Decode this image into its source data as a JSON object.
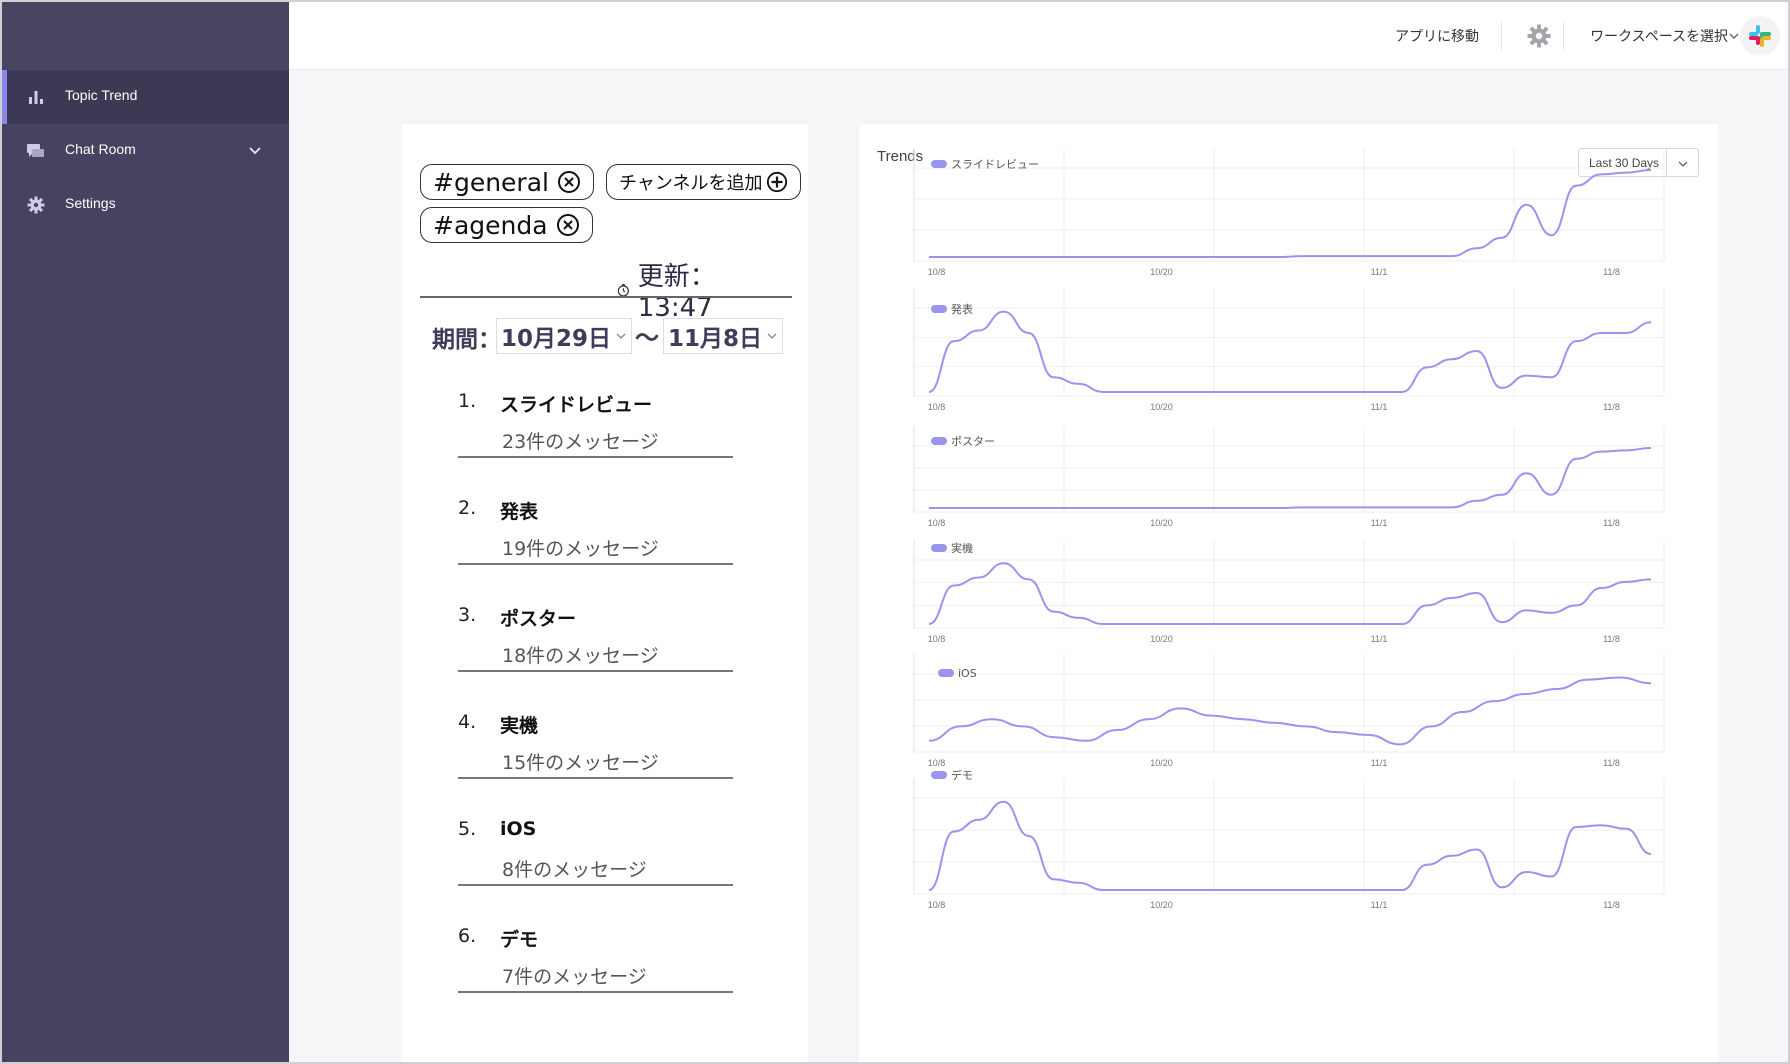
{
  "sidebar": {
    "items": [
      {
        "label": "Topic Trend",
        "icon": "bar-chart-icon",
        "active": true
      },
      {
        "label": "Chat Room",
        "icon": "chat-icon",
        "has_submenu": true
      },
      {
        "label": "Settings",
        "icon": "gear-icon"
      }
    ]
  },
  "topbar": {
    "goto_app": "アプリに移動",
    "workspace_select": "ワークスペースを選択"
  },
  "channels": {
    "chips": [
      "#general",
      "#agenda"
    ],
    "add_label": "チャンネルを追加"
  },
  "update": {
    "label": "更新：13:47"
  },
  "period": {
    "label": "期間：",
    "from": "10月29日",
    "separator": "〜",
    "to": "11月8日"
  },
  "ranking": [
    {
      "num": "1.",
      "name": "スライドレビュー",
      "count": "23件のメッセージ"
    },
    {
      "num": "2.",
      "name": "発表",
      "count": "19件のメッセージ"
    },
    {
      "num": "3.",
      "name": "ポスター",
      "count": "18件のメッセージ"
    },
    {
      "num": "4.",
      "name": "実機",
      "count": "15件のメッセージ"
    },
    {
      "num": "5.",
      "name": "iOS",
      "count": "8件のメッセージ"
    },
    {
      "num": "6.",
      "name": "デモ",
      "count": "7件のメッセージ"
    }
  ],
  "trends": {
    "title": "Trends",
    "period_option": "Last 30 Days"
  },
  "colors": {
    "sidebar_bg": "#45435f",
    "accent": "#8b86ee",
    "line": "#9a93f0"
  },
  "chart_data": [
    {
      "type": "line",
      "series": [
        {
          "name": "スライドレビュー",
          "values": [
            0,
            0,
            0,
            0,
            0,
            0,
            0,
            0,
            0,
            0,
            0,
            0,
            0,
            0,
            0,
            0.01,
            0.01,
            0.01,
            0.01,
            0.01,
            0.01,
            0.01,
            0.1,
            0.22,
            0.6,
            0.25,
            0.82,
            0.95,
            0.97,
            1
          ]
        }
      ],
      "x_ticks": [
        "10/8",
        "10/20",
        "11/1",
        "11/8"
      ]
    },
    {
      "type": "line",
      "series": [
        {
          "name": "発表",
          "values": [
            0,
            0.62,
            0.75,
            0.98,
            0.72,
            0.18,
            0.1,
            0,
            0,
            0,
            0,
            0,
            0,
            0,
            0,
            0,
            0,
            0,
            0,
            0,
            0.3,
            0.4,
            0.5,
            0.05,
            0.2,
            0.18,
            0.62,
            0.72,
            0.72,
            0.85
          ]
        }
      ],
      "x_ticks": [
        "10/8",
        "10/20",
        "11/1",
        "11/8"
      ]
    },
    {
      "type": "line",
      "series": [
        {
          "name": "ポスター",
          "values": [
            0,
            0,
            0,
            0,
            0,
            0,
            0,
            0,
            0,
            0,
            0,
            0,
            0,
            0,
            0,
            0.01,
            0.01,
            0.01,
            0.01,
            0.01,
            0.01,
            0.01,
            0.12,
            0.22,
            0.58,
            0.22,
            0.82,
            0.94,
            0.96,
            1
          ]
        }
      ],
      "x_ticks": [
        "10/8",
        "10/20",
        "11/1",
        "11/8"
      ]
    },
    {
      "type": "line",
      "series": [
        {
          "name": "実機",
          "values": [
            0,
            0.62,
            0.75,
            0.98,
            0.72,
            0.2,
            0.1,
            0,
            0,
            0,
            0,
            0,
            0,
            0,
            0,
            0,
            0,
            0,
            0,
            0,
            0.3,
            0.42,
            0.5,
            0.03,
            0.22,
            0.18,
            0.3,
            0.58,
            0.68,
            0.72
          ]
        }
      ],
      "x_ticks": [
        "10/8",
        "10/20",
        "11/1",
        "11/8"
      ]
    },
    {
      "type": "line",
      "series": [
        {
          "name": "iOS",
          "values": [
            0.1,
            0.3,
            0.4,
            0.3,
            0.15,
            0.1,
            0.25,
            0.4,
            0.55,
            0.45,
            0.4,
            0.35,
            0.3,
            0.22,
            0.18,
            0.05,
            0.3,
            0.5,
            0.65,
            0.75,
            0.82,
            0.95,
            0.98,
            0.9
          ]
        }
      ],
      "x_ticks": [
        "10/8",
        "10/20",
        "11/1",
        "11/8"
      ]
    },
    {
      "type": "line",
      "series": [
        {
          "name": "デモ",
          "values": [
            0,
            0.65,
            0.78,
            0.98,
            0.6,
            0.12,
            0.08,
            0,
            0,
            0,
            0,
            0,
            0,
            0,
            0,
            0,
            0,
            0,
            0,
            0,
            0.28,
            0.38,
            0.45,
            0.03,
            0.2,
            0.15,
            0.7,
            0.72,
            0.68,
            0.4
          ]
        }
      ],
      "x_ticks": [
        "10/8",
        "10/20",
        "11/1",
        "11/8"
      ]
    }
  ]
}
